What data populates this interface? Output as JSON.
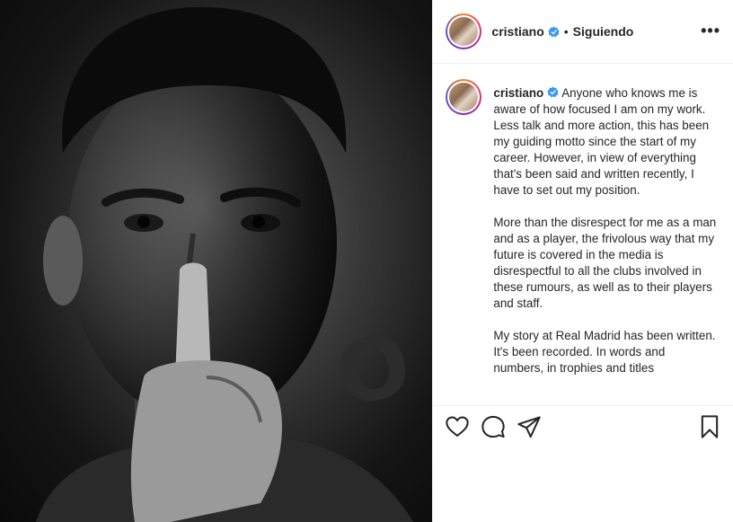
{
  "header": {
    "username": "cristiano",
    "separator": "•",
    "follow_status": "Siguiendo",
    "more_label": "•••"
  },
  "caption": {
    "username": "cristiano",
    "paragraphs": [
      "Anyone who knows me is aware of how focused I am on my work. Less talk and more action, this has been my guiding motto since the start of my career. However, in view of everything that's been said and written recently, I have to set out my position.",
      "More than the disrespect for me as a man and as a player, the frivolous way that my future is covered in the media is disrespectful to all the clubs involved in these rumours, as well as to their players and staff.",
      "My story at Real Madrid has been written. It's been recorded. In words and numbers, in trophies and titles"
    ]
  },
  "actions": {
    "icons": [
      "heart-icon",
      "comment-icon",
      "share-icon",
      "bookmark-icon"
    ]
  },
  "colors": {
    "verified": "#3897f0",
    "text": "#262626",
    "border": "#efefef"
  }
}
